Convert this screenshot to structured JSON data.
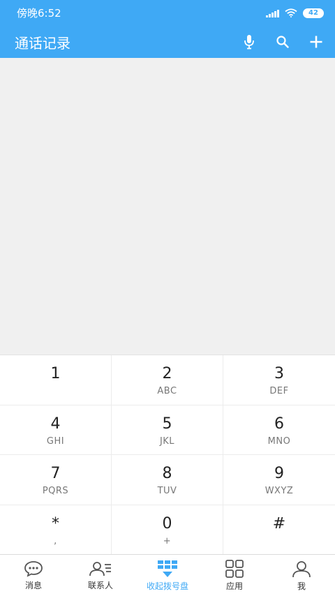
{
  "status_bar": {
    "time": "傍晚6:52",
    "battery": "42"
  },
  "app_bar": {
    "title": "通话记录"
  },
  "dialpad": {
    "keys": [
      {
        "digit": "1",
        "letters": ""
      },
      {
        "digit": "2",
        "letters": "ABC"
      },
      {
        "digit": "3",
        "letters": "DEF"
      },
      {
        "digit": "4",
        "letters": "GHI"
      },
      {
        "digit": "5",
        "letters": "JKL"
      },
      {
        "digit": "6",
        "letters": "MNO"
      },
      {
        "digit": "7",
        "letters": "PQRS"
      },
      {
        "digit": "8",
        "letters": "TUV"
      },
      {
        "digit": "9",
        "letters": "WXYZ"
      },
      {
        "digit": "*",
        "letters": ","
      },
      {
        "digit": "0",
        "letters": "+"
      },
      {
        "digit": "#",
        "letters": ""
      }
    ]
  },
  "bottom_nav": {
    "items": [
      {
        "label": "消息",
        "icon": "message-icon"
      },
      {
        "label": "联系人",
        "icon": "contacts-icon"
      },
      {
        "label": "收起拨号盘",
        "icon": "dialpad-icon",
        "active": true
      },
      {
        "label": "应用",
        "icon": "apps-icon"
      },
      {
        "label": "我",
        "icon": "profile-icon"
      }
    ]
  },
  "colors": {
    "accent": "#3fa9f5",
    "content_bg": "#f0f0f0"
  }
}
